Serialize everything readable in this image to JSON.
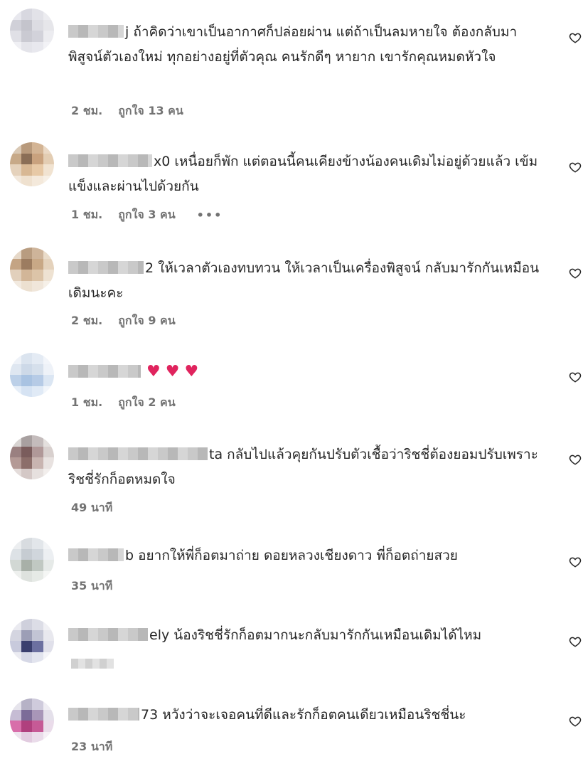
{
  "comments": [
    {
      "name_tail": "j",
      "text": "ถ้าคิดว่าเขาเป็นอากาศก็ปล่อยผ่าน แต่ถ้าเป็นลมหายใจ ต้องกลับมาพิสูจน์ตัวเองใหม่ ทุกอย่างอยู่ที่ตัวคุณ คนรักดีๆ หายาก เขารักคุณหมดหัวใจ",
      "time": "2 ชม.",
      "likes": "ถูกใจ 13 คน"
    },
    {
      "name_tail": "x0",
      "text": "เหนื่อยก็พัก แต่ตอนนี้คนเคียงข้างน้องคนเดิมไม่อยู่ด้วยแล้ว เข้มแข็งและผ่านไปด้วยกัน",
      "time": "1 ชม.",
      "likes": "ถูกใจ 3 คน",
      "more": "•••"
    },
    {
      "name_tail": "2",
      "text": "ให้เวลาตัวเองทบทวน ให้เวลาเป็นเครื่องพิสูจน์ กลับมารักกันเหมือนเดิมนะคะ",
      "time": "2 ชม.",
      "likes": "ถูกใจ 9 คน"
    },
    {
      "name_tail": "",
      "text": "",
      "emoji": "♥ ♥ ♥",
      "time": "1 ชม.",
      "likes": "ถูกใจ 2 คน"
    },
    {
      "name_tail": "ta",
      "text": "กลับไปแล้วคุยกันปรับตัวเชื้อว่าริชชี่ต้องยอมปรับเพราะริชชี่รักก็อตหมดใจ",
      "time": "49 นาที"
    },
    {
      "name_tail": "b",
      "text": "อยากให้พี่ก็อตมาถ่าย ดอยหลวงเชียงดาว พี่ก็อตถ่ายสวย",
      "time": "35 นาที"
    },
    {
      "name_tail": "ely",
      "text": "น้องริชชี่รักก็อตมากนะกลับมารักกันเหมือนเดิมได้ไหม",
      "time": ""
    },
    {
      "name_tail": "73",
      "text": "หวังว่าจะเจอคนที่ดีและรักก็อตคนเดียวเหมือนริชชี่นะ",
      "time": "23 นาที"
    }
  ],
  "icons": {
    "like": "heart-outline-icon"
  },
  "colors": {
    "text": "#262626",
    "meta": "#737373",
    "emoji_heart": "#e0245e"
  }
}
